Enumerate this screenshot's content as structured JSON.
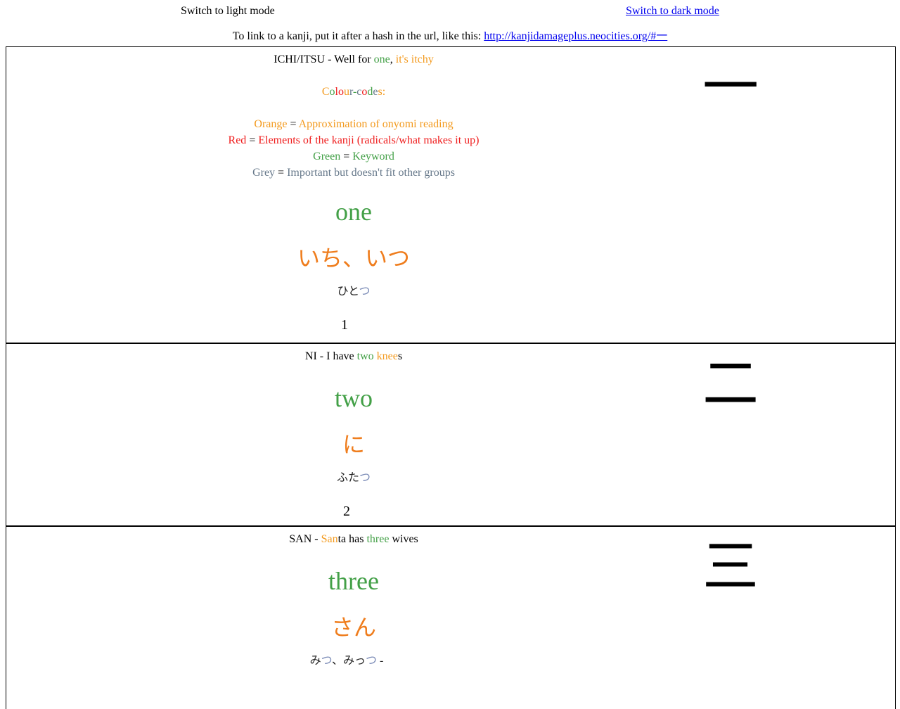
{
  "header": {
    "light_mode_label": "Switch to light mode",
    "dark_mode_label": "Switch to dark mode",
    "link_hint": "To link to a kanji, put it after a hash in the url, like this: ",
    "link_url_text": "http://kanjidamageplus.neocities.org/#一"
  },
  "colours": {
    "orange": "#f39a1e",
    "red": "#ef1c1c",
    "green": "#43a047",
    "grey": "#66788a",
    "reading_orange": "#ef7d1d",
    "kun_blue": "#7d8db8",
    "link_blue": "#0000ee"
  },
  "legend": {
    "title_letters": [
      {
        "ch": "C",
        "c": "orange"
      },
      {
        "ch": "o",
        "c": "green"
      },
      {
        "ch": "l",
        "c": "red"
      },
      {
        "ch": "o",
        "c": "red"
      },
      {
        "ch": "u",
        "c": "orange"
      },
      {
        "ch": "r",
        "c": "grey"
      },
      {
        "ch": "-",
        "c": "green"
      },
      {
        "ch": "c",
        "c": "grey"
      },
      {
        "ch": "o",
        "c": "red"
      },
      {
        "ch": "d",
        "c": "green"
      },
      {
        "ch": "e",
        "c": "grey"
      },
      {
        "ch": "s",
        "c": "orange"
      },
      {
        "ch": ":",
        "c": "orange"
      }
    ],
    "rows": [
      {
        "name": "Orange",
        "eq": " = ",
        "desc": "Approximation of onyomi reading",
        "c": "orange"
      },
      {
        "name": "Red",
        "eq": " = ",
        "desc": "Elements of the kanji (radicals/what makes it up)",
        "c": "red"
      },
      {
        "name": "Green",
        "eq": " = ",
        "desc": "Keyword",
        "c": "green"
      },
      {
        "name": "Grey",
        "eq": " = ",
        "desc": "Important but doesn't fit other groups",
        "c": "grey"
      }
    ]
  },
  "kanji": [
    {
      "title_segments": [
        {
          "t": "ICHI/ITSU - Well for ",
          "c": "black"
        },
        {
          "t": "one",
          "c": "green"
        },
        {
          "t": ", ",
          "c": "black"
        },
        {
          "t": "it's itchy",
          "c": "orange"
        }
      ],
      "keyword": "one",
      "onyomi": "いち、いつ",
      "kun_segments": [
        {
          "t": "ひと",
          "blue": false
        },
        {
          "t": "つ",
          "blue": true
        }
      ],
      "number": "1",
      "character": "一"
    },
    {
      "title_segments": [
        {
          "t": "NI - I have ",
          "c": "black"
        },
        {
          "t": "two",
          "c": "green"
        },
        {
          "t": " ",
          "c": "black"
        },
        {
          "t": "knee",
          "c": "orange"
        },
        {
          "t": "s",
          "c": "black"
        }
      ],
      "keyword": "two",
      "onyomi": "に",
      "kun_segments": [
        {
          "t": "ふた",
          "blue": false
        },
        {
          "t": "つ",
          "blue": true
        }
      ],
      "number": "2",
      "character": "二"
    },
    {
      "title_segments": [
        {
          "t": "SAN - ",
          "c": "black"
        },
        {
          "t": "San",
          "c": "orange"
        },
        {
          "t": "ta has ",
          "c": "black"
        },
        {
          "t": "three",
          "c": "green"
        },
        {
          "t": " wives",
          "c": "black"
        }
      ],
      "keyword": "three",
      "onyomi": "さん",
      "kun_segments": [
        {
          "t": "み",
          "blue": false
        },
        {
          "t": "つ",
          "blue": true
        },
        {
          "t": "、みっ",
          "blue": false
        },
        {
          "t": "つ",
          "blue": true
        },
        {
          "t": " -",
          "blue": false
        }
      ],
      "number": "",
      "character": "三"
    }
  ]
}
